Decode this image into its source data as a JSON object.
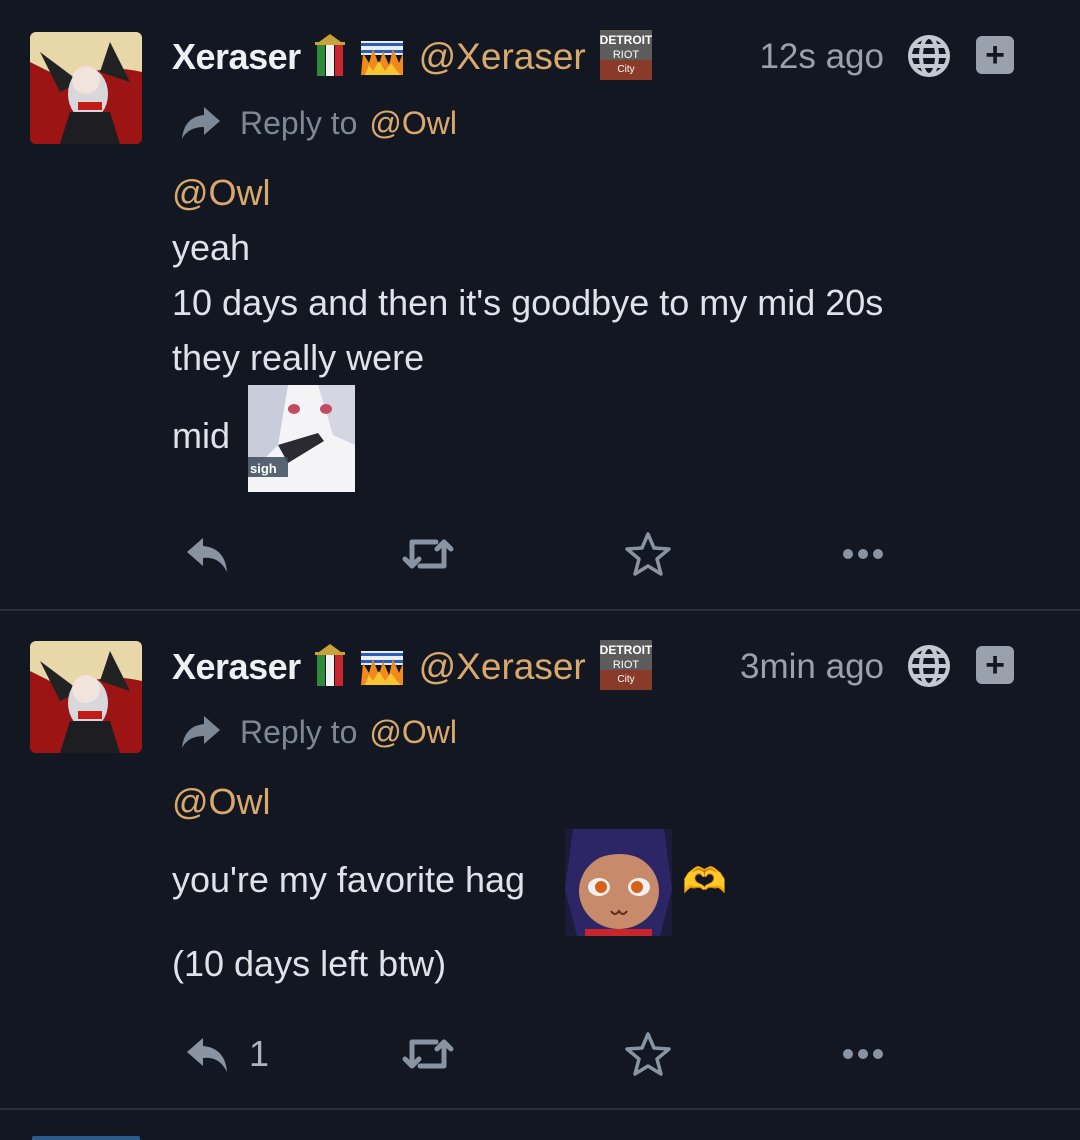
{
  "posts": [
    {
      "display_name": "Xeraser",
      "handle": "@Xeraser",
      "timestamp": "12s ago",
      "reply_prefix": "Reply to",
      "reply_to": "@Owl",
      "mention": "@Owl",
      "lines": [
        "yeah",
        "10 days and then it's goodbye to my mid 20s",
        "they really were"
      ],
      "last_line": "mid",
      "emoji_caption": "sigh",
      "reply_count": ""
    },
    {
      "display_name": "Xeraser",
      "handle": "@Xeraser",
      "timestamp": "3min ago",
      "reply_prefix": "Reply to",
      "reply_to": "@Owl",
      "mention": "@Owl",
      "line_1": "you're my favorite hag",
      "heart_emoji": "🫶",
      "line_2": "(10 days left btw)",
      "reply_count": "1"
    }
  ],
  "badge_text": {
    "detroit": "DETROIT",
    "riot": "RIOT",
    "city": "City"
  },
  "colors": {
    "background": "#121721",
    "text": "#dfe2e8",
    "accent": "#d9a86c",
    "muted": "#8a93a2",
    "divider": "#262d3b"
  },
  "icons": {
    "reply": "reply-arrow-icon",
    "boost": "boost-icon",
    "favourite": "star-icon",
    "more": "ellipsis-icon",
    "visibility": "globe-icon",
    "expand": "plus-icon"
  }
}
